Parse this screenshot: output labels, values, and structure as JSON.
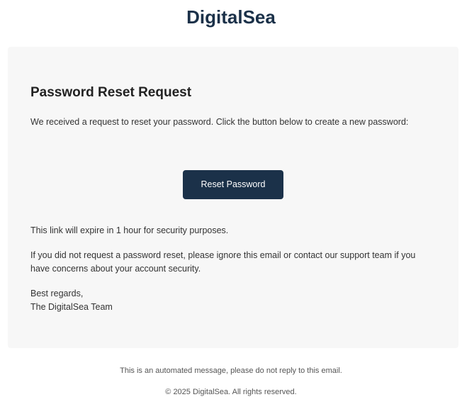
{
  "header": {
    "brand": "DigitalSea"
  },
  "card": {
    "title": "Password Reset Request",
    "intro": "We received a request to reset your password. Click the button below to create a new password:",
    "button_label": "Reset Password",
    "expiry_note": "This link will expire in 1 hour for security purposes.",
    "ignore_note": "If you did not request a password reset, please ignore this email or contact our support team if you have concerns about your account security.",
    "signoff_line1": "Best regards,",
    "signoff_line2": "The DigitalSea Team"
  },
  "footer": {
    "note": "This is an automated message, please do not reply to this email.",
    "copyright": "© 2025 DigitalSea. All rights reserved."
  },
  "colors": {
    "brand": "#1b3149",
    "card_background": "#f7f7f7"
  }
}
